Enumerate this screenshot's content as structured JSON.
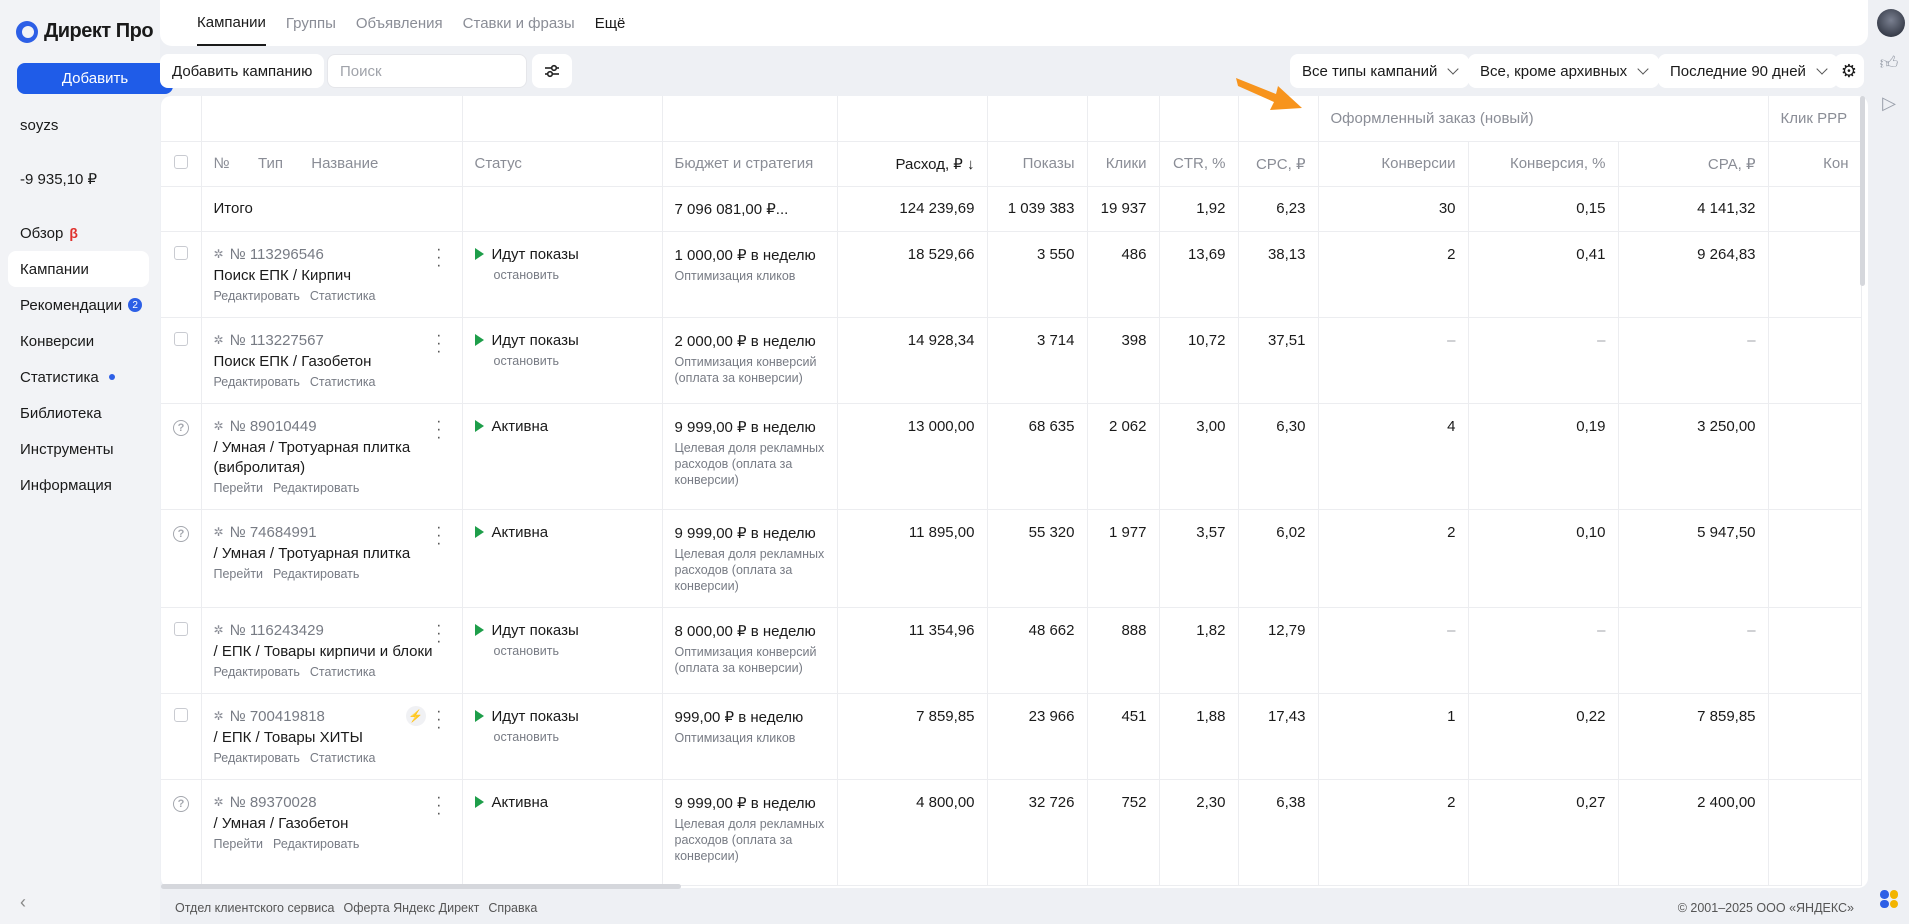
{
  "app": {
    "logo": "Директ Про"
  },
  "sidebar": {
    "add_label": "Добавить",
    "account": "soyzs",
    "balance": "-9 935,10 ₽",
    "items": [
      {
        "label": "Обзор",
        "marker": "β"
      },
      {
        "label": "Кампании",
        "active": true
      },
      {
        "label": "Рекомендации",
        "badge": "2"
      },
      {
        "label": "Конверсии"
      },
      {
        "label": "Статистика",
        "dot": true
      },
      {
        "label": "Библиотека"
      },
      {
        "label": "Инструменты"
      },
      {
        "label": "Информация"
      }
    ]
  },
  "tabs": [
    "Кампании",
    "Группы",
    "Объявления",
    "Ставки и фразы",
    "Ещё"
  ],
  "toolbar": {
    "add_campaign": "Добавить кампанию",
    "search_placeholder": "Поиск",
    "filter_type": "Все типы кампаний",
    "filter_archive": "Все, кроме архивных",
    "filter_period": "Последние 90 дней"
  },
  "table": {
    "group_headers": {
      "order": "Оформленный заказ (новый)",
      "click": "Клик РРР"
    },
    "headers": {
      "num": "№",
      "type": "Тип",
      "name": "Название",
      "status": "Статус",
      "budget": "Бюджет и стратегия",
      "spend": "Расход, ₽ ↓",
      "impr": "Показы",
      "clicks": "Клики",
      "ctr": "CTR, %",
      "cpc": "CPC, ₽",
      "conv": "Конверсии",
      "conv_rate": "Конверсия, %",
      "cpa": "CPA, ₽",
      "extra": "Кон"
    },
    "total": {
      "label": "Итого",
      "budget": "7 096 081,00 ₽...",
      "spend": "124 239,69",
      "impr": "1 039 383",
      "clicks": "19 937",
      "ctr": "1,92",
      "cpc": "6,23",
      "conv": "30",
      "conv_rate": "0,15",
      "cpa": "4 141,32"
    },
    "rows": [
      {
        "id": "№ 113296546",
        "name": "Поиск ЕПК / Кирпич",
        "links": [
          "Редактировать",
          "Статистика"
        ],
        "status": "Идут показы",
        "status_sub": "остановить",
        "budget": "1 000,00 ₽ в неделю",
        "strategy": "Оптимизация кликов",
        "spend": "18 529,66",
        "impr": "3 550",
        "clicks": "486",
        "ctr": "13,69",
        "cpc": "38,13",
        "conv": "2",
        "conv_rate": "0,41",
        "cpa": "9 264,83",
        "check": "box"
      },
      {
        "id": "№ 113227567",
        "name": "Поиск ЕПК / Газобетон",
        "links": [
          "Редактировать",
          "Статистика"
        ],
        "status": "Идут показы",
        "status_sub": "остановить",
        "budget": "2 000,00 ₽ в неделю",
        "strategy": "Оптимизация конверсий (оплата за конверсии)",
        "spend": "14 928,34",
        "impr": "3 714",
        "clicks": "398",
        "ctr": "10,72",
        "cpc": "37,51",
        "conv": "–",
        "conv_rate": "–",
        "cpa": "–",
        "check": "box"
      },
      {
        "id": "№ 89010449",
        "name": "/ Умная / Тротуарная плитка (вибролитая)",
        "links": [
          "Перейти",
          "Редактировать"
        ],
        "status": "Активна",
        "status_sub": "",
        "budget": "9 999,00 ₽ в неделю",
        "strategy": "Целевая доля рекламных расходов (оплата за конверсии)",
        "spend": "13 000,00",
        "impr": "68 635",
        "clicks": "2 062",
        "ctr": "3,00",
        "cpc": "6,30",
        "conv": "4",
        "conv_rate": "0,19",
        "cpa": "3 250,00",
        "check": "q"
      },
      {
        "id": "№ 74684991",
        "name": "/ Умная / Тротуарная плитка",
        "links": [
          "Перейти",
          "Редактировать"
        ],
        "status": "Активна",
        "status_sub": "",
        "budget": "9 999,00 ₽ в неделю",
        "strategy": "Целевая доля рекламных расходов (оплата за конверсии)",
        "spend": "11 895,00",
        "impr": "55 320",
        "clicks": "1 977",
        "ctr": "3,57",
        "cpc": "6,02",
        "conv": "2",
        "conv_rate": "0,10",
        "cpa": "5 947,50",
        "check": "q"
      },
      {
        "id": "№ 116243429",
        "name": "/ ЕПК / Товары кирпичи и блоки",
        "links": [
          "Редактировать",
          "Статистика"
        ],
        "status": "Идут показы",
        "status_sub": "остановить",
        "budget": "8 000,00 ₽ в неделю",
        "strategy": "Оптимизация конверсий (оплата за конверсии)",
        "spend": "11 354,96",
        "impr": "48 662",
        "clicks": "888",
        "ctr": "1,82",
        "cpc": "12,79",
        "conv": "–",
        "conv_rate": "–",
        "cpa": "–",
        "check": "box"
      },
      {
        "id": "№ 700419818",
        "name": "/ ЕПК / Товары ХИТЫ",
        "links": [
          "Редактировать",
          "Статистика"
        ],
        "status": "Идут показы",
        "status_sub": "остановить",
        "budget": "999,00 ₽ в неделю",
        "strategy": "Оптимизация кликов",
        "spend": "7 859,85",
        "impr": "23 966",
        "clicks": "451",
        "ctr": "1,88",
        "cpc": "17,43",
        "conv": "1",
        "conv_rate": "0,22",
        "cpa": "7 859,85",
        "check": "box",
        "bolt": true
      },
      {
        "id": "№ 89370028",
        "name": "/ Умная / Газобетон",
        "links": [
          "Перейти",
          "Редактировать"
        ],
        "status": "Активна",
        "status_sub": "",
        "budget": "9 999,00 ₽ в неделю",
        "strategy": "Целевая доля рекламных расходов (оплата за конверсии)",
        "spend": "4 800,00",
        "impr": "32 726",
        "clicks": "752",
        "ctr": "2,30",
        "cpc": "6,38",
        "conv": "2",
        "conv_rate": "0,27",
        "cpa": "2 400,00",
        "check": "q"
      }
    ]
  },
  "footer": {
    "links": [
      "Отдел клиентского сервиса",
      "Оферта Яндекс Директ",
      "Справка"
    ],
    "copyright": "© 2001–2025 ООО «ЯНДЕКС»"
  },
  "colors": {
    "accent": "#1f5ce8",
    "status_green": "#1e9e4a",
    "arrow": "#f7941d"
  }
}
